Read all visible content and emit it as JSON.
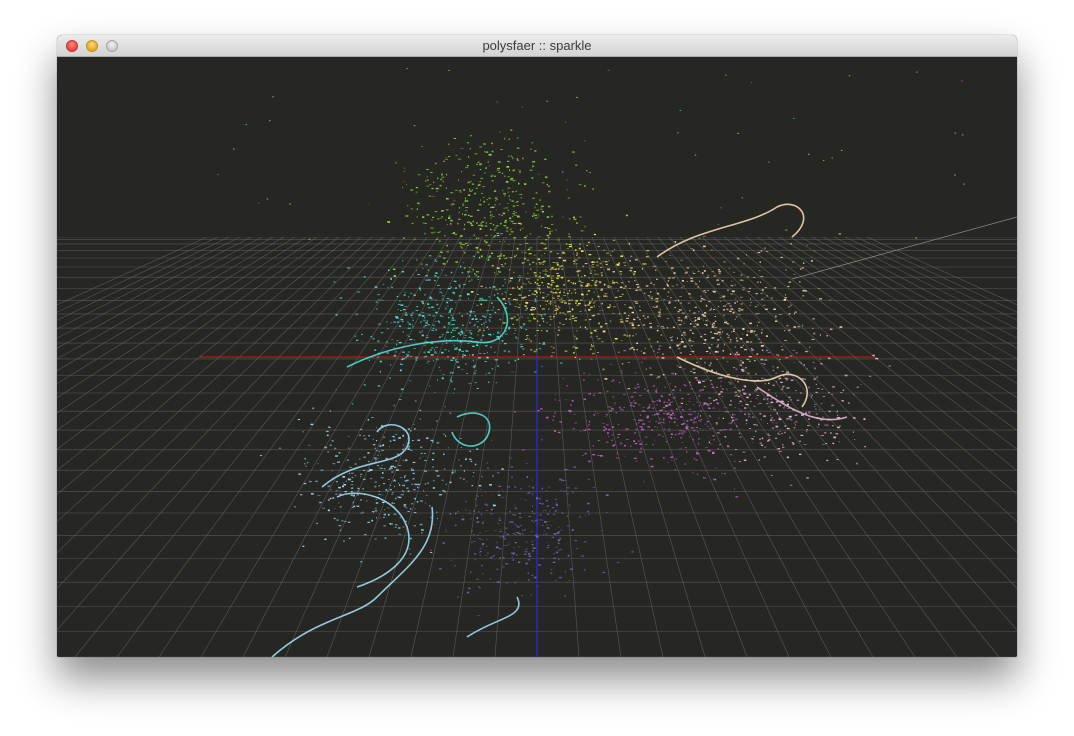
{
  "window": {
    "title": "polysfaer :: sparkle"
  },
  "titlebar": {
    "buttons": [
      {
        "name": "close",
        "color": "#e0443e"
      },
      {
        "name": "minimize",
        "color": "#e3a623"
      },
      {
        "name": "zoom",
        "color": "#c8c8c8"
      }
    ]
  },
  "scene": {
    "background_color": "#262622",
    "grid_color": "#6a6a66",
    "x_axis_color": "#d01818",
    "z_axis_color": "#2a2ad8",
    "particle_clusters": [
      {
        "name": "green-cluster",
        "color": "#9be34a"
      },
      {
        "name": "yellow-cluster",
        "color": "#f2ef5a"
      },
      {
        "name": "cyan-cluster",
        "color": "#56e8dc"
      },
      {
        "name": "peach-cluster",
        "color": "#ffe0b8"
      },
      {
        "name": "magenta-cluster",
        "color": "#c060c8"
      },
      {
        "name": "light-blue-cluster",
        "color": "#a8e4ff"
      },
      {
        "name": "violet-cluster",
        "color": "#7a68c8"
      },
      {
        "name": "pink-cluster",
        "color": "#f0c0e0"
      }
    ]
  }
}
